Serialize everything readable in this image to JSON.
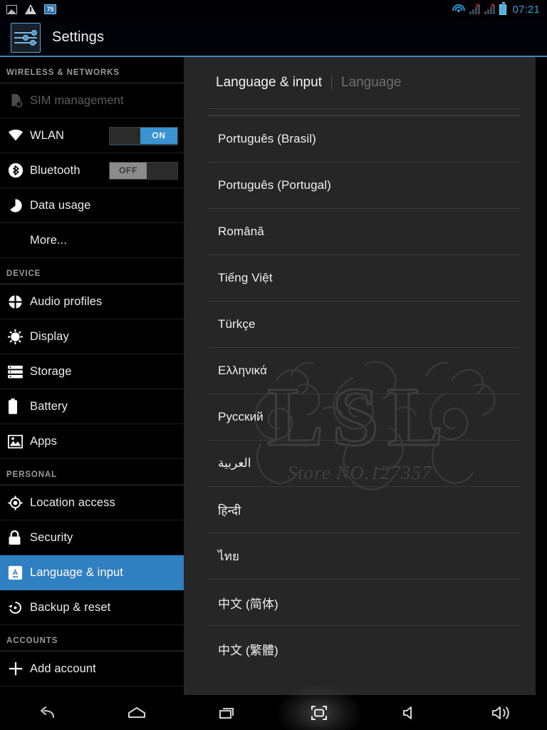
{
  "statusbar": {
    "icons_left": [
      "screenshot-icon",
      "warning-icon",
      "count-badge"
    ],
    "badge_value": "75",
    "icons_right": [
      "wifi-icon",
      "signal-1-icon",
      "signal-2-icon",
      "battery-icon"
    ],
    "time": "07:21"
  },
  "titlebar": {
    "app_icon": "settings-sliders-icon",
    "title": "Settings"
  },
  "sidebar": {
    "sections": [
      {
        "header": "WIRELESS & NETWORKS",
        "items": [
          {
            "label": "SIM management",
            "icon": "sim-card-icon",
            "state": "disabled"
          },
          {
            "label": "WLAN",
            "icon": "wifi-icon",
            "toggle": "ON"
          },
          {
            "label": "Bluetooth",
            "icon": "bluetooth-icon",
            "toggle": "OFF"
          },
          {
            "label": "Data usage",
            "icon": "pie-chart-icon"
          },
          {
            "label": "More...",
            "icon": ""
          }
        ]
      },
      {
        "header": "DEVICE",
        "items": [
          {
            "label": "Audio profiles",
            "icon": "audio-profiles-icon"
          },
          {
            "label": "Display",
            "icon": "brightness-icon"
          },
          {
            "label": "Storage",
            "icon": "storage-icon"
          },
          {
            "label": "Battery",
            "icon": "battery-icon"
          },
          {
            "label": "Apps",
            "icon": "apps-icon"
          }
        ]
      },
      {
        "header": "PERSONAL",
        "items": [
          {
            "label": "Location access",
            "icon": "location-icon"
          },
          {
            "label": "Security",
            "icon": "lock-icon"
          },
          {
            "label": "Language & input",
            "icon": "language-a-icon",
            "state": "selected"
          },
          {
            "label": "Backup & reset",
            "icon": "backup-reset-icon"
          }
        ]
      },
      {
        "header": "ACCOUNTS",
        "items": [
          {
            "label": "Add account",
            "icon": "plus-icon"
          }
        ]
      }
    ]
  },
  "content": {
    "breadcrumb": {
      "parent": "Language & input",
      "current": "Language"
    },
    "languages": [
      "Português (Brasil)",
      "Português (Portugal)",
      "Română",
      "Tiếng Việt",
      "Türkçe",
      "Ελληνικά",
      "Русский",
      "العربية",
      "हिन्दी",
      "ไทย",
      "中文 (简体)",
      "中文 (繁體)"
    ],
    "watermark": {
      "letters": "LSL",
      "subtitle": "Store NO.127357"
    }
  },
  "navbar": {
    "buttons": [
      {
        "name": "back-icon",
        "label": "Back"
      },
      {
        "name": "home-icon",
        "label": "Home"
      },
      {
        "name": "recents-icon",
        "label": "Recent apps"
      },
      {
        "name": "screenshot-icon",
        "label": "Screenshot",
        "highlighted": true
      },
      {
        "name": "volume-down-icon",
        "label": "Volume down"
      },
      {
        "name": "volume-up-icon",
        "label": "Volume up"
      }
    ]
  },
  "colors": {
    "accent_blue": "#2f7fc1",
    "toggle_on_blue": "#3b92d0",
    "panel_bg": "#262626",
    "sidebar_bg": "#000000",
    "status_time": "#2f9fd8"
  }
}
